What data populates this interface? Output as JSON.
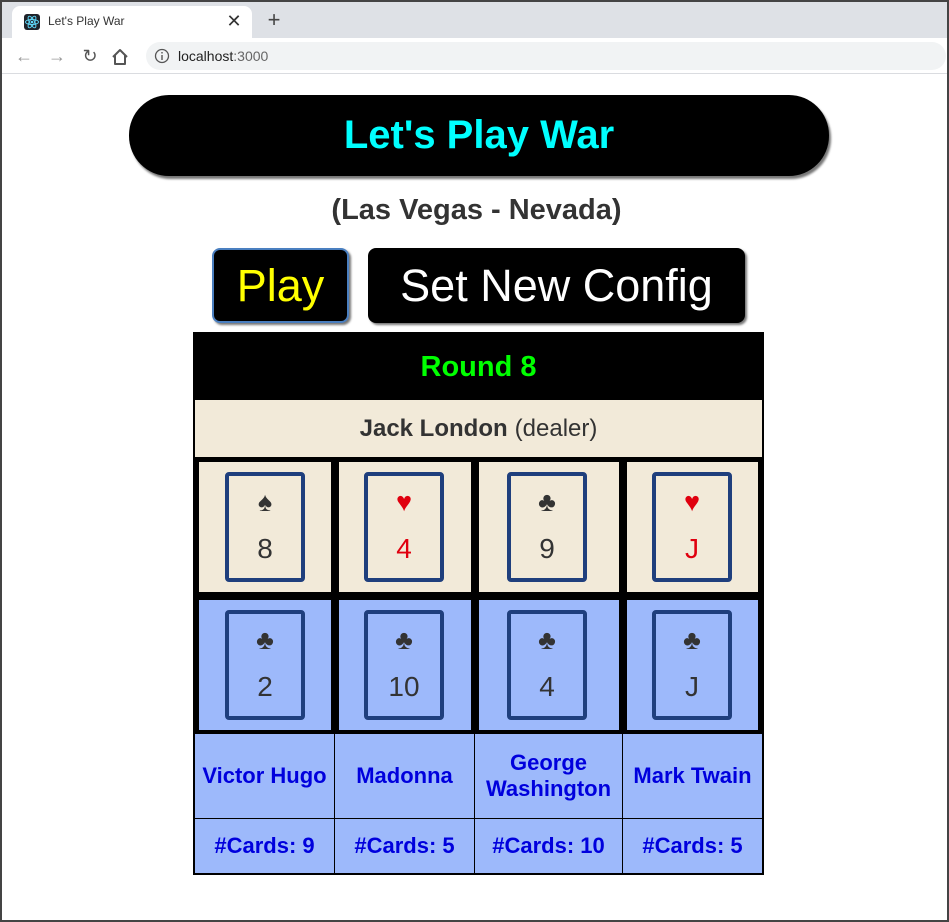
{
  "browser": {
    "tab_title": "Let's Play War",
    "url_host": "localhost",
    "url_port": ":3000",
    "icons": [
      "react-icon",
      "close-icon",
      "plus-icon",
      "back-arrow-icon",
      "forward-arrow-icon",
      "reload-icon",
      "home-icon",
      "info-icon"
    ]
  },
  "app": {
    "title": "Let's Play War",
    "location": "(Las Vegas - Nevada)",
    "play_label": "Play",
    "config_label": "Set New Config",
    "round_label": "Round 8",
    "dealer_name": "Jack London",
    "dealer_suffix": "(dealer)",
    "dealer_cards": [
      {
        "suit": "♠",
        "rank": "8",
        "color": "black"
      },
      {
        "suit": "♥",
        "rank": "4",
        "color": "red"
      },
      {
        "suit": "♣",
        "rank": "9",
        "color": "black"
      },
      {
        "suit": "♥",
        "rank": "J",
        "color": "red"
      }
    ],
    "player_cards": [
      {
        "suit": "♣",
        "rank": "2",
        "color": "black"
      },
      {
        "suit": "♣",
        "rank": "10",
        "color": "black"
      },
      {
        "suit": "♣",
        "rank": "4",
        "color": "black"
      },
      {
        "suit": "♣",
        "rank": "J",
        "color": "black"
      }
    ],
    "players": [
      {
        "name": "Victor Hugo",
        "cards": "#Cards: 9"
      },
      {
        "name": "Madonna",
        "cards": "#Cards: 5"
      },
      {
        "name": "George Washington",
        "cards": "#Cards: 10"
      },
      {
        "name": "Mark Twain",
        "cards": "#Cards: 5"
      }
    ]
  },
  "colors": {
    "title_text": "#00ffff",
    "play_text": "#ffff00",
    "round_text": "#00ff00",
    "dealer_bg": "#f2ead9",
    "player_bg": "#9db9fb",
    "player_text": "#0000dd",
    "card_border": "#1f3f7d",
    "red_suit": "#e0000f"
  }
}
